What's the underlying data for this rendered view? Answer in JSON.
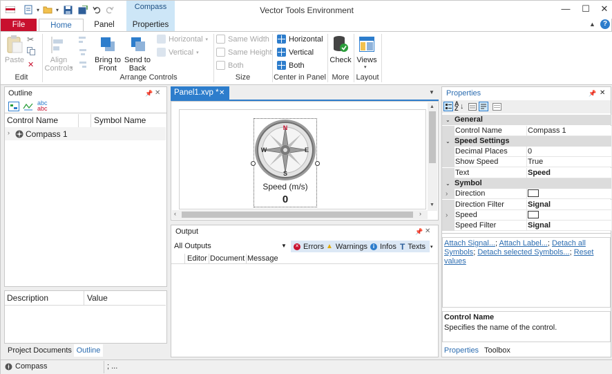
{
  "window": {
    "title": "Vector Tools Environment",
    "minimize": "—",
    "maximize": "☐",
    "close": "✕"
  },
  "ribbon_tabs": {
    "file": "File",
    "home": "Home",
    "panel": "Panel",
    "context_group": "Compass",
    "properties": "Properties"
  },
  "ribbon": {
    "edit": {
      "paste": "Paste",
      "label": "Edit"
    },
    "arrange": {
      "align": "Align\nControls",
      "bring_front": "Bring to\nFront",
      "send_back": "Send to\nBack",
      "label": "Arrange Controls",
      "horizontal": "Horizontal",
      "vertical": "Vertical"
    },
    "size": {
      "same_width": "Same Width",
      "same_height": "Same Height",
      "both": "Both",
      "label": "Size"
    },
    "center": {
      "horizontal": "Horizontal",
      "vertical": "Vertical",
      "both": "Both",
      "label": "Center in Panel"
    },
    "more": {
      "check": "Check",
      "label": "More"
    },
    "layout": {
      "views": "Views",
      "label": "Layout"
    }
  },
  "outline": {
    "title": "Outline",
    "col_control": "Control Name",
    "col_symbol": "Symbol Name",
    "items": [
      {
        "name": "Compass 1",
        "symbol": ""
      }
    ],
    "desc_col": "Description",
    "value_col": "Value",
    "bottom_tabs": [
      "Project Documents",
      "Outline"
    ]
  },
  "document": {
    "tab": "Panel1.xvp *",
    "compass_label": "Speed (m/s)",
    "compass_value": "0",
    "needle_letters": {
      "n": "N",
      "e": "E",
      "s": "S",
      "w": "W"
    }
  },
  "output": {
    "title": "Output",
    "filter": "All Outputs",
    "errors": "Errors",
    "warnings": "Warnings",
    "infos": "Infos",
    "texts": "Texts",
    "columns": [
      "Editor",
      "Document",
      "Message"
    ]
  },
  "properties": {
    "title": "Properties",
    "rows": [
      {
        "type": "cat",
        "label": "General"
      },
      {
        "type": "prop",
        "name": "Control Name",
        "value": "Compass 1",
        "bold": false
      },
      {
        "type": "cat",
        "label": "Speed Settings"
      },
      {
        "type": "prop",
        "name": "Decimal Places",
        "value": "0",
        "bold": false
      },
      {
        "type": "prop",
        "name": "Show Speed",
        "value": "True",
        "bold": false
      },
      {
        "type": "prop",
        "name": "Text",
        "value": "Speed",
        "bold": true
      },
      {
        "type": "cat",
        "label": "Symbol"
      },
      {
        "type": "prop",
        "name": "Direction",
        "value": "",
        "bold": false,
        "box": true,
        "expand": true
      },
      {
        "type": "prop",
        "name": "Direction Filter",
        "value": "Signal",
        "bold": true
      },
      {
        "type": "prop",
        "name": "Speed",
        "value": "",
        "bold": false,
        "box": true,
        "expand": true
      },
      {
        "type": "prop",
        "name": "Speed Filter",
        "value": "Signal",
        "bold": true
      }
    ],
    "links": [
      "Attach Signal...",
      "Attach Label...",
      "Detach all Symbols",
      "Detach selected Symbols...",
      "Reset values"
    ],
    "help_title": "Control Name",
    "help_text": "Specifies the name of the control.",
    "bottom_tabs": [
      "Properties",
      "Toolbox"
    ]
  },
  "statusbar": {
    "item": "Compass",
    "info": "; ..."
  },
  "colors": {
    "accent": "#2d7dcc",
    "file_tab": "#c8102e",
    "context": "#cde6f7"
  }
}
